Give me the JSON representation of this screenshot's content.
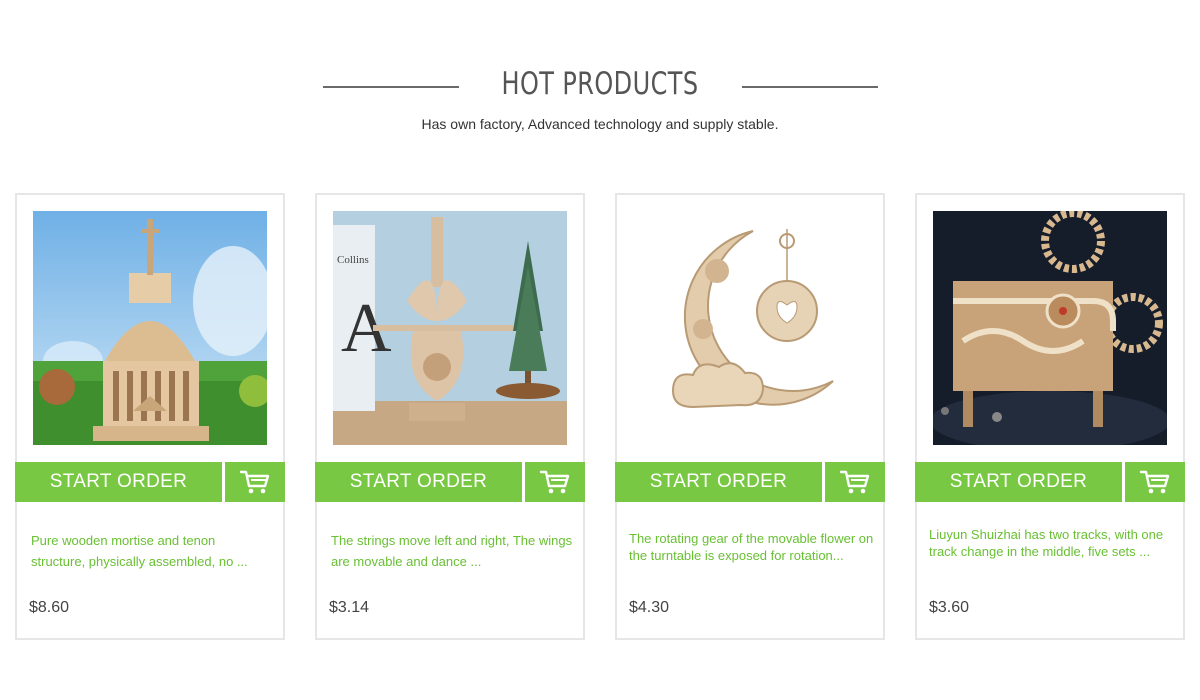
{
  "header": {
    "title": "HOT PRODUCTS",
    "subtitle": "Has own factory, Advanced technology and supply stable."
  },
  "colors": {
    "accent": "#78c843",
    "description_text": "#69c033",
    "border": "#e6e6e6"
  },
  "products": [
    {
      "order_label": "START ORDER",
      "cart_icon": "cart-icon",
      "description": "Pure wooden mortise and tenon structure, physically assembled, no ...",
      "price": "$8.60"
    },
    {
      "order_label": "START ORDER",
      "cart_icon": "cart-icon",
      "description": "The strings move left and right,  The wings are movable and dance ...",
      "price": "$3.14"
    },
    {
      "order_label": "START ORDER",
      "cart_icon": "cart-icon",
      "description": "The rotating gear of the movable flower on the turntable is exposed for rotation...",
      "price": "$4.30"
    },
    {
      "order_label": "START ORDER",
      "cart_icon": "cart-icon",
      "description": "Liuyun Shuizhai has two tracks, with one track change in the middle,  five sets ...",
      "price": "$3.60"
    }
  ]
}
